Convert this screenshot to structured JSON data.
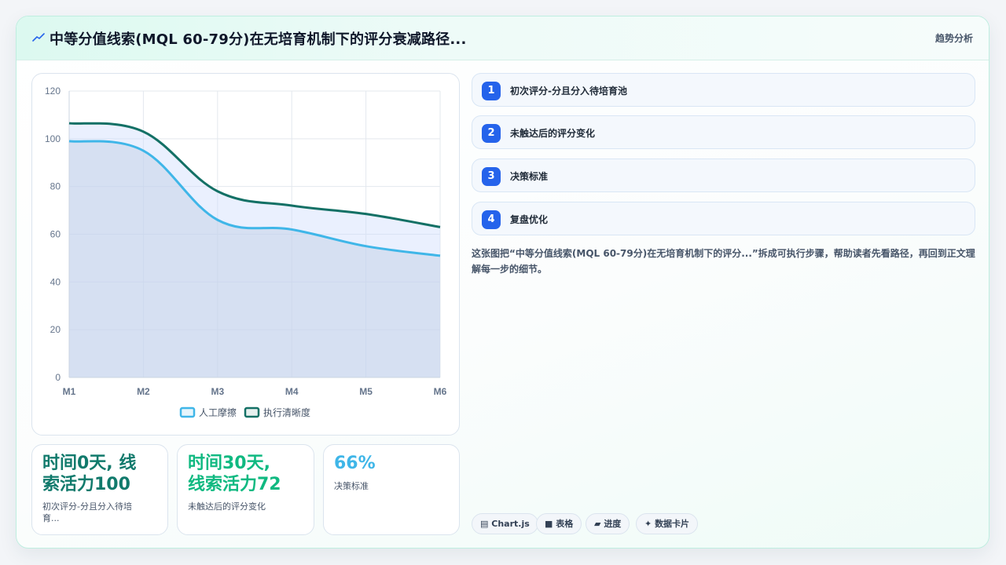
{
  "header": {
    "icon": "trend-icon",
    "title": "中等分值线索(MQL 60-79分)在无培育机制下的评分衰减路径...",
    "badge": "趋势分析"
  },
  "chart_data": {
    "type": "area",
    "x": [
      "M1",
      "M2",
      "M3",
      "M4",
      "M5",
      "M6"
    ],
    "series": [
      {
        "name": "人工摩擦",
        "values": [
          99,
          95,
          66,
          62,
          55,
          51
        ],
        "color": "#3fb6e8"
      },
      {
        "name": "执行清晰度",
        "values": [
          106.5,
          103,
          78,
          72,
          68.5,
          63
        ],
        "color": "#137065"
      }
    ],
    "ylim": [
      0,
      120
    ],
    "yticks": [
      "0",
      "20",
      "40",
      "60",
      "80",
      "100",
      "120"
    ],
    "grid": true,
    "legend_position": "bottom"
  },
  "stats": [
    {
      "value_line1": "时间0天, 线",
      "value_line2": "索活力100",
      "label_line1": "初次评分-分且分入待培",
      "label_line2": "育...",
      "color": "#117a6c"
    },
    {
      "value_line1": "时间30天,",
      "value_line2": "线索活力72",
      "label_line1": "未触达后的评分变化",
      "label_line2": "",
      "color": "#10b981"
    },
    {
      "value_line1": "66%",
      "value_line2": "",
      "label_line1": "决策标准",
      "label_line2": "",
      "color": "#3fb6e8"
    }
  ],
  "steps": [
    {
      "num": "1",
      "label": "初次评分-分且分入待培育池"
    },
    {
      "num": "2",
      "label": "未触达后的评分变化"
    },
    {
      "num": "3",
      "label": "决策标准"
    },
    {
      "num": "4",
      "label": "复盘优化"
    }
  ],
  "description": "这张图把“中等分值线索(MQL 60-79分)在无培育机制下的评分...”拆成可执行步骤，帮助读者先看路径，再回到正文理解每一步的细节。",
  "tags": [
    {
      "icon": "chart-icon",
      "label": "Chart.js"
    },
    {
      "icon": "table-icon",
      "label": "表格"
    },
    {
      "icon": "progress-icon",
      "label": "进度"
    },
    {
      "icon": "sparkle-icon",
      "label": "数据卡片"
    }
  ]
}
